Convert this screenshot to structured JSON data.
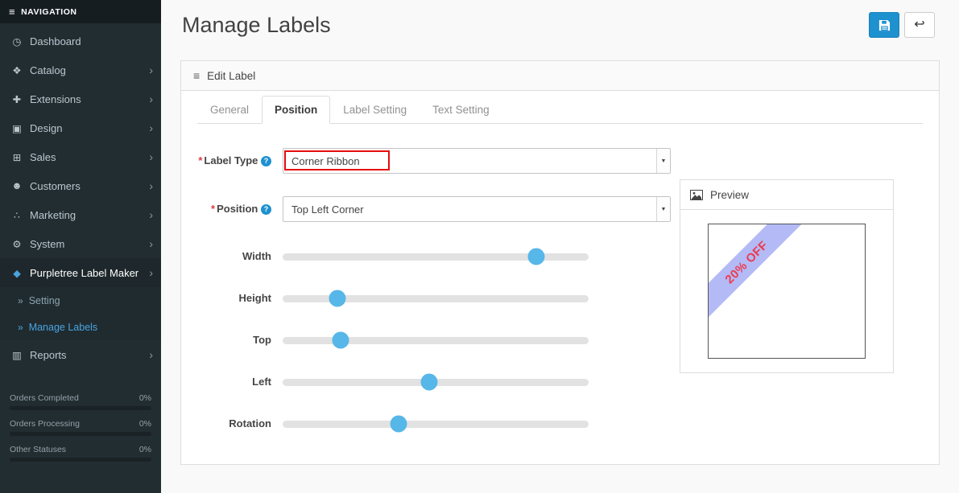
{
  "colors": {
    "sidebar_bg": "#222d32",
    "sidebar_header_bg": "#161d21",
    "accent_blue": "#1e91cf",
    "link_blue": "#4aa3df",
    "slider_handle": "#57b7e8",
    "highlight_red": "#e60c0c",
    "ribbon_fill": "rgba(116,130,238,0.55)",
    "ribbon_text_color": "#ee3a4e"
  },
  "markers": {
    "required": "*"
  },
  "icons": {
    "hamburger": "≡",
    "panel_list": "≡",
    "chevron_right": "›",
    "submenu_marker": "»",
    "help": "?",
    "back": "↩",
    "dropdown_arrow": "▼"
  },
  "sidebar": {
    "header": "NAVIGATION",
    "items": [
      {
        "id": "dashboard",
        "label": "Dashboard",
        "icon": "dashboard-icon",
        "glyph": "◷",
        "chevron": false
      },
      {
        "id": "catalog",
        "label": "Catalog",
        "icon": "tags-icon",
        "glyph": "❖",
        "chevron": true
      },
      {
        "id": "extensions",
        "label": "Extensions",
        "icon": "puzzle-icon",
        "glyph": "✚",
        "chevron": true
      },
      {
        "id": "design",
        "label": "Design",
        "icon": "monitor-icon",
        "glyph": "▣",
        "chevron": true
      },
      {
        "id": "sales",
        "label": "Sales",
        "icon": "cart-icon",
        "glyph": "⊞",
        "chevron": true
      },
      {
        "id": "customers",
        "label": "Customers",
        "icon": "user-icon",
        "glyph": "☻",
        "chevron": true
      },
      {
        "id": "marketing",
        "label": "Marketing",
        "icon": "share-icon",
        "glyph": "∴",
        "chevron": true
      },
      {
        "id": "system",
        "label": "System",
        "icon": "gear-icon",
        "glyph": "⚙",
        "chevron": true
      },
      {
        "id": "purpletree-label-maker",
        "label": "Purpletree Label Maker",
        "icon": "tag-icon",
        "glyph": "◆",
        "chevron": true,
        "active": true,
        "submenu": [
          {
            "id": "setting",
            "label": "Setting",
            "active": false
          },
          {
            "id": "manage-labels",
            "label": "Manage Labels",
            "active": true
          }
        ]
      },
      {
        "id": "reports",
        "label": "Reports",
        "icon": "bar-chart-icon",
        "glyph": "▥",
        "chevron": true
      }
    ],
    "stats": [
      {
        "label": "Orders Completed",
        "value": "0%",
        "fill": 0
      },
      {
        "label": "Orders Processing",
        "value": "0%",
        "fill": 0
      },
      {
        "label": "Other Statuses",
        "value": "0%",
        "fill": 0
      }
    ]
  },
  "header": {
    "title": "Manage Labels"
  },
  "panel": {
    "title": "Edit Label"
  },
  "tabs": [
    {
      "id": "general",
      "label": "General",
      "active": false
    },
    {
      "id": "position",
      "label": "Position",
      "active": true
    },
    {
      "id": "label-setting",
      "label": "Label Setting",
      "active": false
    },
    {
      "id": "text-setting",
      "label": "Text Setting",
      "active": false
    }
  ],
  "form": {
    "fields": [
      {
        "id": "label-type",
        "label": "Label Type",
        "required": true,
        "help": true,
        "value": "Corner Ribbon",
        "highlighted": true
      },
      {
        "id": "position",
        "label": "Position",
        "required": true,
        "help": true,
        "value": "Top Left Corner",
        "highlighted": false
      }
    ],
    "sliders": [
      {
        "id": "width",
        "label": "Width",
        "percent": 83
      },
      {
        "id": "height",
        "label": "Height",
        "percent": 18
      },
      {
        "id": "top",
        "label": "Top",
        "percent": 19
      },
      {
        "id": "left",
        "label": "Left",
        "percent": 48
      },
      {
        "id": "rotation",
        "label": "Rotation",
        "percent": 38
      }
    ]
  },
  "preview": {
    "title": "Preview",
    "ribbon_text": "20% OFF"
  }
}
